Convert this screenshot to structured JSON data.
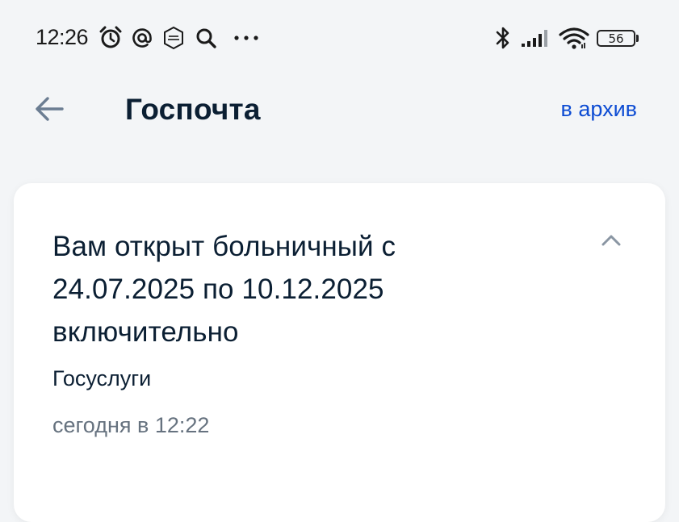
{
  "status_bar": {
    "time": "12:26",
    "icons": [
      "alarm-icon",
      "at-icon",
      "gosuslugi-icon",
      "search-icon",
      "more-icon"
    ],
    "right_icons": [
      "bluetooth-icon",
      "signal-icon",
      "wifi-icon"
    ],
    "battery": "56"
  },
  "app_bar": {
    "back_icon": "arrow-left-icon",
    "title": "Госпочта",
    "archive_label": "в архив",
    "accent_color": "#0d4cd3"
  },
  "message": {
    "title": "Вам открыт больничный с 24.07.2025 по 10.12.2025 включительно",
    "sender": "Госуслуги",
    "timestamp": "сегодня в 12:22",
    "collapse_icon": "chevron-up-icon"
  }
}
